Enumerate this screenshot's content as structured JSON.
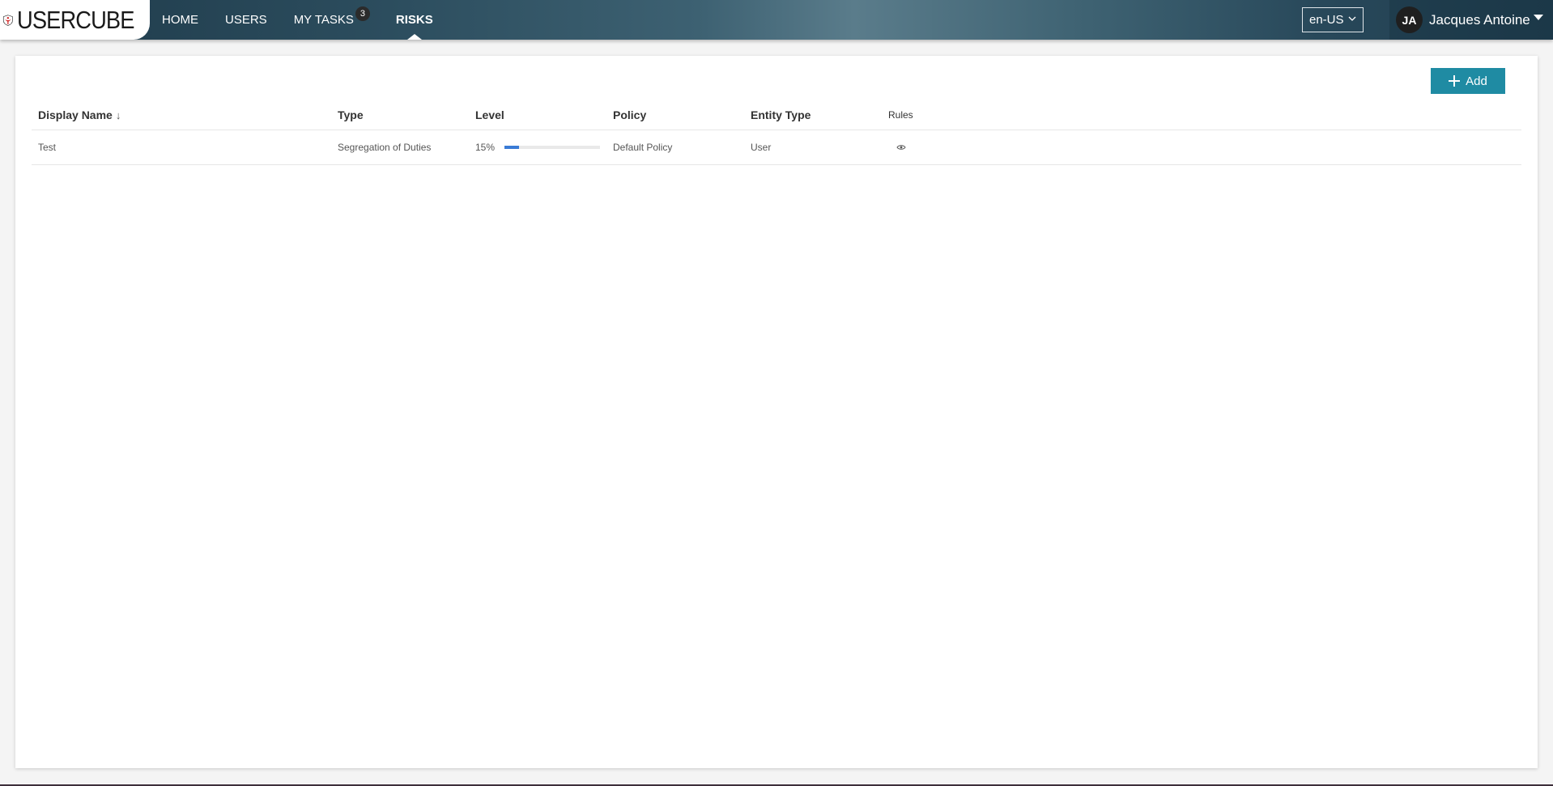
{
  "brand": {
    "name": "USERCUBE"
  },
  "nav": {
    "items": [
      {
        "label": "HOME"
      },
      {
        "label": "USERS"
      },
      {
        "label": "MY TASKS",
        "badge": "3"
      },
      {
        "label": "RISKS",
        "active": true
      }
    ]
  },
  "language": {
    "value": "en-US"
  },
  "user": {
    "initials": "JA",
    "name": "Jacques Antoine"
  },
  "toolbar": {
    "add_label": "Add"
  },
  "table": {
    "columns": [
      "Display Name",
      "Type",
      "Level",
      "Policy",
      "Entity Type",
      "Rules"
    ],
    "sort_indicator": "↓",
    "rows": [
      {
        "display_name": "Test",
        "type": "Segregation of Duties",
        "level_label": "15%",
        "level_fraction": 0.15,
        "policy": "Default Policy",
        "entity_type": "User"
      }
    ]
  },
  "colors": {
    "accent": "#1f8ba3",
    "level_bar": "#3a7bd5",
    "logo_red": "#d22b2b"
  }
}
